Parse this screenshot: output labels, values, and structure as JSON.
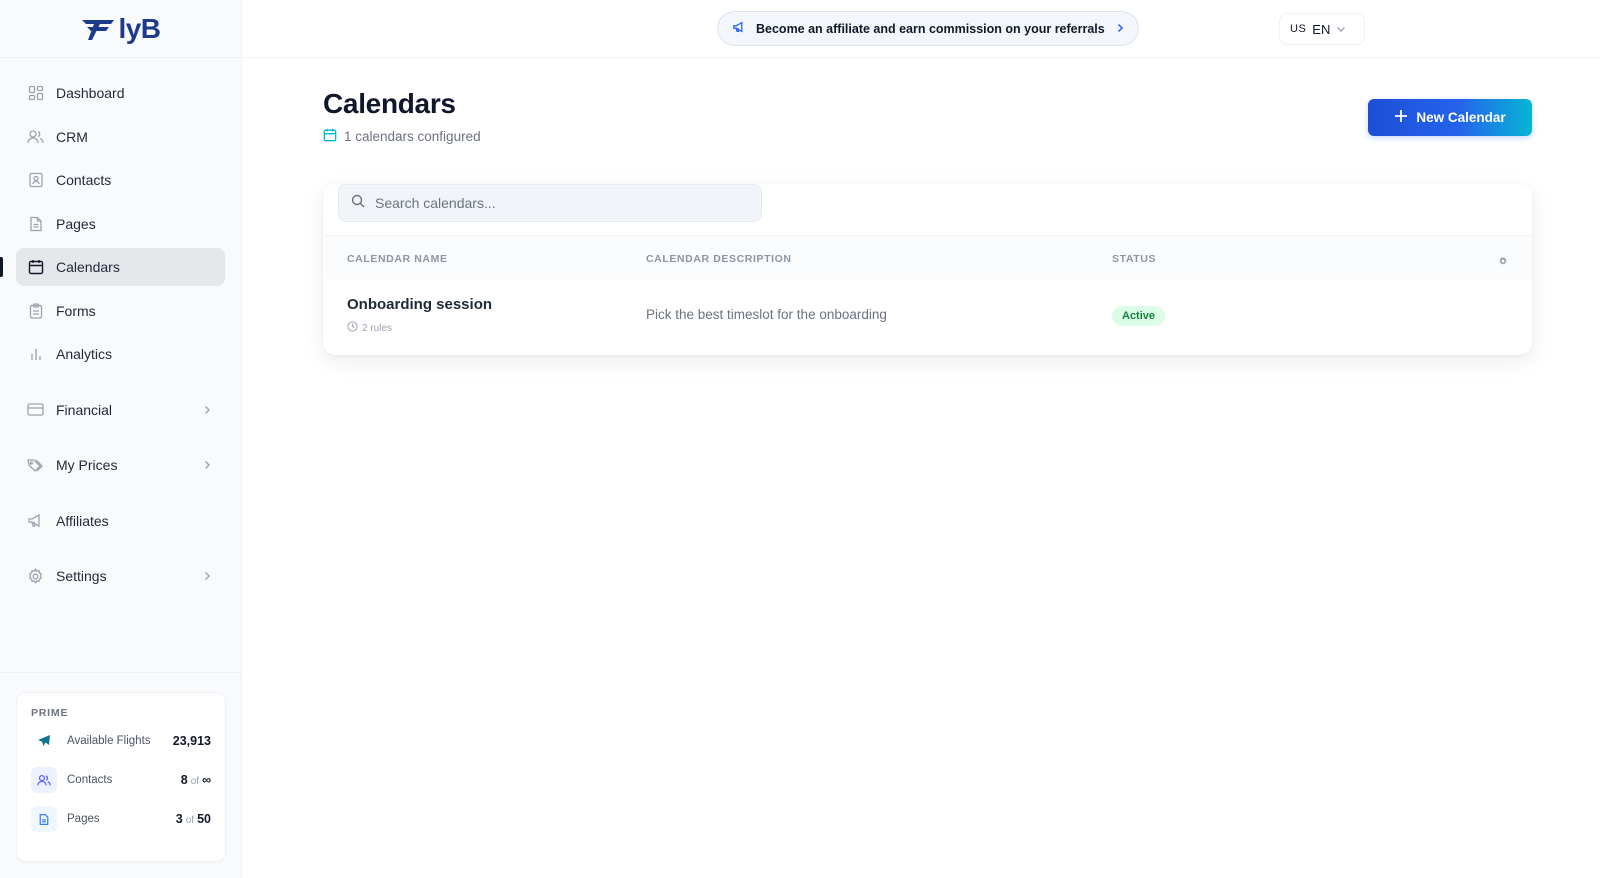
{
  "brand": {
    "logo_text": "lyB"
  },
  "sidebar": {
    "items": [
      {
        "label": "Dashboard",
        "icon": "dashboard-icon"
      },
      {
        "label": "CRM",
        "icon": "users-icon"
      },
      {
        "label": "Contacts",
        "icon": "contacts-icon"
      },
      {
        "label": "Pages",
        "icon": "page-icon"
      },
      {
        "label": "Calendars",
        "icon": "calendar-icon",
        "active": true
      },
      {
        "label": "Forms",
        "icon": "clipboard-icon"
      },
      {
        "label": "Analytics",
        "icon": "bar-chart-icon"
      },
      {
        "label": "Financial",
        "icon": "credit-card-icon",
        "has_children": true
      },
      {
        "label": "My Prices",
        "icon": "tag-icon",
        "has_children": true
      },
      {
        "label": "Affiliates",
        "icon": "megaphone-icon"
      },
      {
        "label": "Settings",
        "icon": "gear-icon",
        "has_children": true
      }
    ]
  },
  "prime": {
    "title": "PRIME",
    "flights": {
      "label": "Available Flights",
      "value": "23,913"
    },
    "contacts": {
      "label": "Contacts",
      "value": "8",
      "of": "of",
      "max": "∞"
    },
    "pages": {
      "label": "Pages",
      "value": "3",
      "of": "of",
      "max": "50"
    }
  },
  "topbar": {
    "affiliate_text": "Become an affiliate and earn commission on your referrals",
    "lang_country": "US",
    "lang_code": "EN"
  },
  "page": {
    "title": "Calendars",
    "subtitle": "1 calendars configured",
    "new_button": "New Calendar"
  },
  "search": {
    "placeholder": "Search calendars..."
  },
  "table": {
    "columns": [
      "CALENDAR NAME",
      "CALENDAR DESCRIPTION",
      "STATUS"
    ],
    "rows": [
      {
        "name": "Onboarding session",
        "rules": "2 rules",
        "description": "Pick the best timeslot for the onboarding",
        "status": "Active"
      }
    ]
  },
  "colors": {
    "accent": "#2563eb",
    "accent_end": "#06b6d4",
    "active_bg": "#dcfce7",
    "active_text": "#15803d"
  }
}
